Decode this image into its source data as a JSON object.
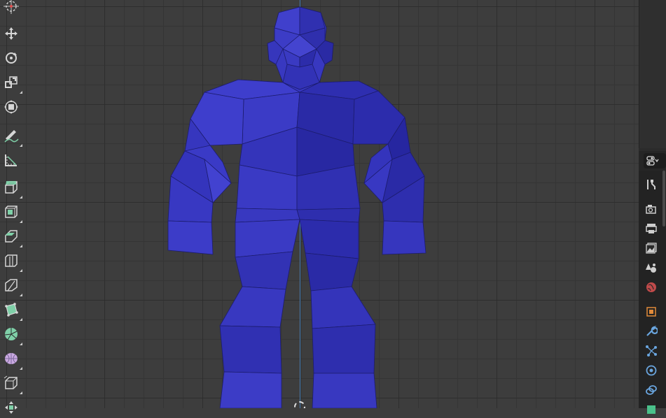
{
  "viewport": {
    "mode": "Edit Mode",
    "mesh_color": "#3b3bc8",
    "mesh_edge_color": "#1a1a6a"
  },
  "toolbar": {
    "tools": [
      {
        "name": "cursor",
        "icon": "cursor-icon"
      },
      {
        "name": "move",
        "icon": "move-icon"
      },
      {
        "name": "rotate",
        "icon": "rotate-icon"
      },
      {
        "name": "scale",
        "icon": "scale-icon"
      },
      {
        "name": "transform",
        "icon": "transform-icon"
      },
      {
        "name": "annotate",
        "icon": "annotate-icon"
      },
      {
        "name": "measure",
        "icon": "measure-icon"
      },
      {
        "name": "extrude-region",
        "icon": "extrude-icon"
      },
      {
        "name": "inset-faces",
        "icon": "inset-icon"
      },
      {
        "name": "bevel",
        "icon": "bevel-icon"
      },
      {
        "name": "loop-cut",
        "icon": "loop-cut-icon"
      },
      {
        "name": "knife",
        "icon": "knife-icon"
      },
      {
        "name": "poly-build",
        "icon": "poly-build-icon"
      },
      {
        "name": "spin",
        "icon": "spin-icon"
      },
      {
        "name": "smooth",
        "icon": "smooth-icon"
      },
      {
        "name": "edge-slide",
        "icon": "edge-slide-icon"
      },
      {
        "name": "shrink-fatten",
        "icon": "shrink-fatten-icon"
      }
    ]
  },
  "properties": {
    "tabs": [
      "tool",
      "render",
      "output",
      "view-layer",
      "scene",
      "world",
      "object",
      "modifiers",
      "particles",
      "physics",
      "constraints",
      "data"
    ]
  }
}
